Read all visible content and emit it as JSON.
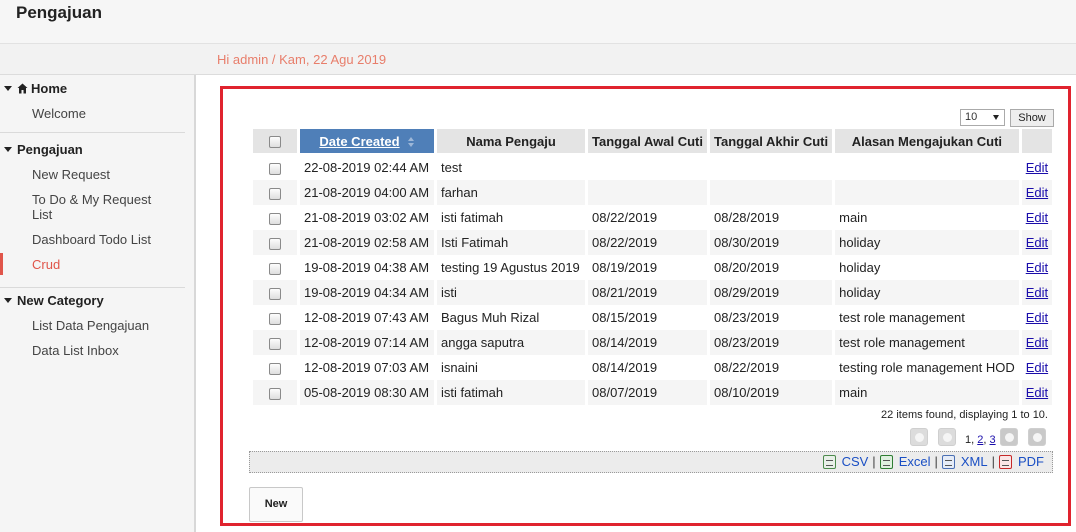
{
  "header": {
    "title": "Pengajuan"
  },
  "greeting": "Hi admin / Kam, 22 Agu 2019",
  "sidebar": {
    "sections": [
      {
        "label": "Home",
        "items": [
          {
            "label": "Welcome"
          }
        ]
      },
      {
        "label": "Pengajuan",
        "items": [
          {
            "label": "New Request"
          },
          {
            "label": "To Do & My Request List"
          },
          {
            "label": "Dashboard Todo List"
          },
          {
            "label": "Crud"
          }
        ]
      },
      {
        "label": "New Category",
        "items": [
          {
            "label": "List Data Pengajuan"
          },
          {
            "label": "Data List Inbox"
          }
        ]
      }
    ],
    "active_item": "Crud"
  },
  "pagesize": {
    "value": "10",
    "show_label": "Show"
  },
  "table": {
    "columns": [
      "Date Created",
      "Nama Pengaju",
      "Tanggal Awal Cuti",
      "Tanggal Akhir Cuti",
      "Alasan Mengajukan Cuti"
    ],
    "edit_label": "Edit",
    "rows": [
      [
        "22-08-2019 02:44 AM",
        "test",
        "",
        "",
        ""
      ],
      [
        "21-08-2019 04:00 AM",
        "farhan",
        "",
        "",
        ""
      ],
      [
        "21-08-2019 03:02 AM",
        "isti fatimah",
        "08/22/2019",
        "08/28/2019",
        "main"
      ],
      [
        "21-08-2019 02:58 AM",
        "Isti Fatimah",
        "08/22/2019",
        "08/30/2019",
        "holiday"
      ],
      [
        "19-08-2019 04:38 AM",
        "testing 19 Agustus 2019",
        "08/19/2019",
        "08/20/2019",
        "holiday"
      ],
      [
        "19-08-2019 04:34 AM",
        "isti",
        "08/21/2019",
        "08/29/2019",
        "holiday"
      ],
      [
        "12-08-2019 07:43 AM",
        "Bagus Muh Rizal",
        "08/15/2019",
        "08/23/2019",
        "test role management"
      ],
      [
        "12-08-2019 07:14 AM",
        "angga saputra",
        "08/14/2019",
        "08/23/2019",
        "test role management"
      ],
      [
        "12-08-2019 07:03 AM",
        "isnaini",
        "08/14/2019",
        "08/22/2019",
        "testing role management HOD"
      ],
      [
        "05-08-2019 08:30 AM",
        "isti fatimah",
        "08/07/2019",
        "08/10/2019",
        "main"
      ]
    ]
  },
  "pagination": {
    "summary": "22 items found, displaying 1 to 10.",
    "current": "1",
    "pages": [
      "2",
      "3"
    ]
  },
  "export": {
    "csv": "CSV",
    "excel": "Excel",
    "xml": "XML",
    "pdf": "PDF"
  },
  "new_button": "New"
}
